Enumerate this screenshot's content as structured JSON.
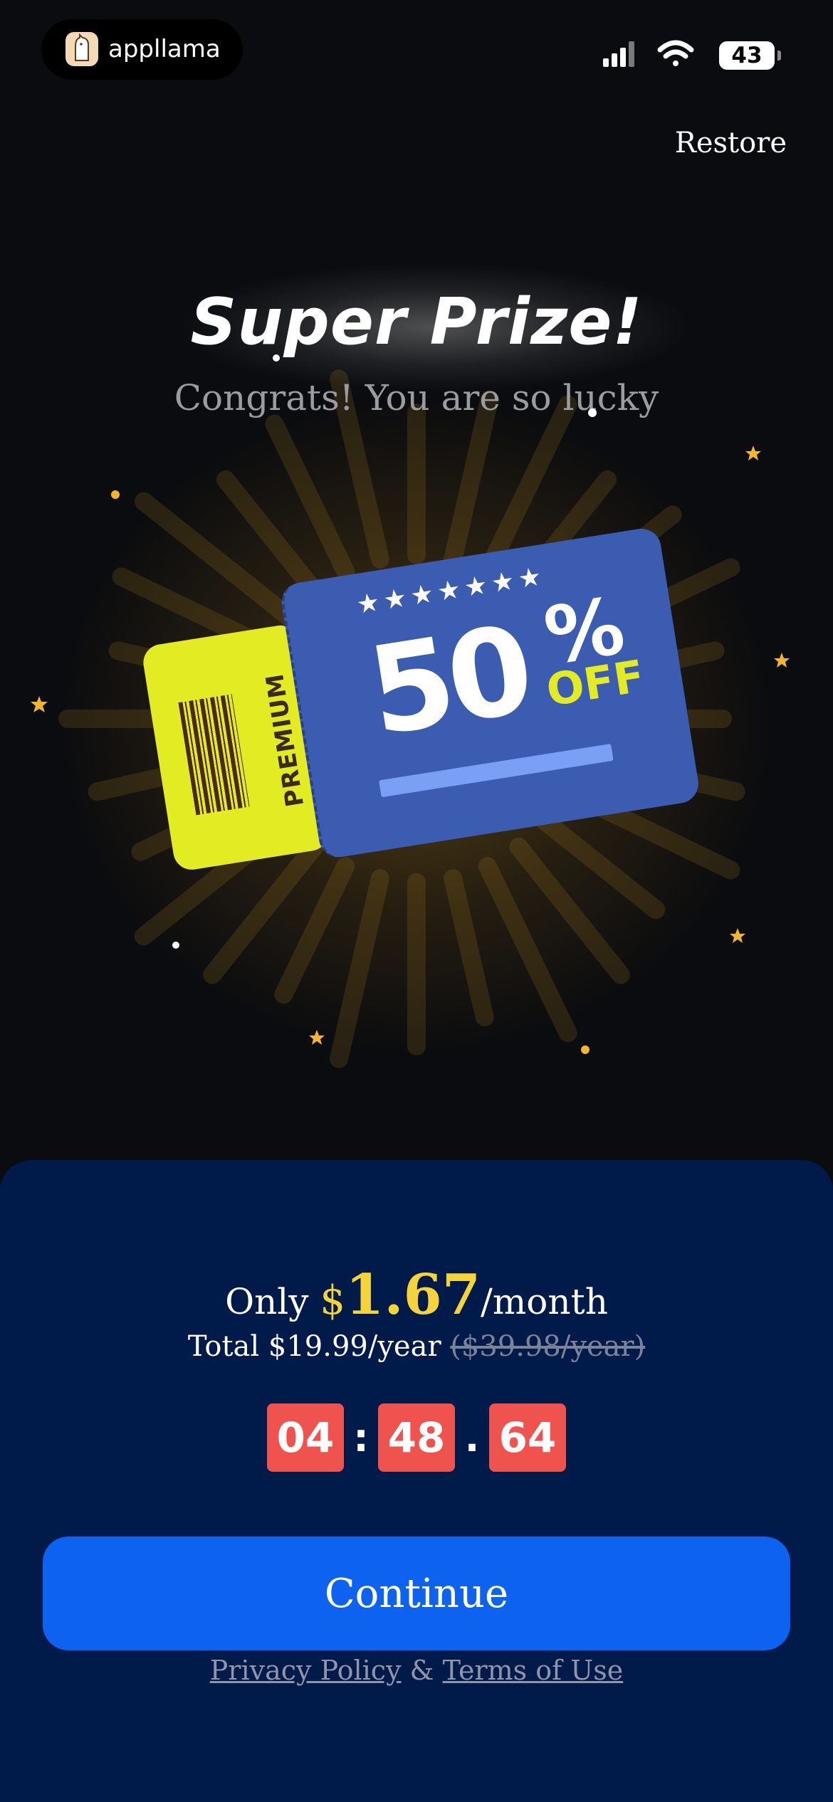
{
  "status_bar": {
    "app_name": "appllama",
    "battery_level": "43"
  },
  "header": {
    "restore_label": "Restore"
  },
  "hero": {
    "title": "Super Prize!",
    "subtitle": "Congrats! You are so lucky"
  },
  "coupon": {
    "stub_label": "PREMIUM",
    "stars": "★★★★★★★",
    "discount_value": "50",
    "discount_symbol": "%",
    "discount_suffix": "OFF",
    "stub_color": "#e3ec22",
    "ticket_color": "#3b5cb1"
  },
  "pricing": {
    "prefix": "Only",
    "currency": "$",
    "amount": "1.67",
    "period": "/month",
    "total_text": "Total $19.99/year",
    "original_text": "($39.98/year)",
    "accent_color": "#f5d33b"
  },
  "countdown": {
    "hours": "04",
    "minutes": "48",
    "centis": "64",
    "sep1": ":",
    "sep2": ".",
    "box_color": "#f0524e"
  },
  "cta": {
    "continue_label": "Continue",
    "button_color": "#0d63f0"
  },
  "legal": {
    "privacy_label": "Privacy Policy",
    "joiner": "&",
    "terms_label": "Terms of Use"
  },
  "icons": {
    "status_icons": [
      "cellular-signal-icon",
      "wifi-icon",
      "battery-icon"
    ],
    "brand_logo": "llama-logo-icon"
  }
}
